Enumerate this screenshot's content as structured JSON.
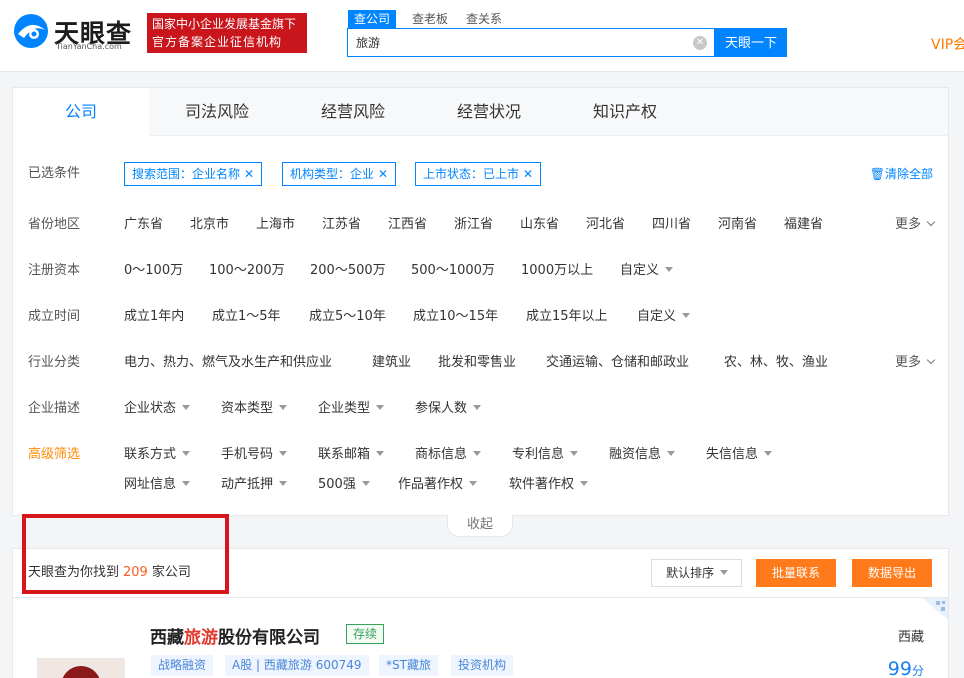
{
  "header": {
    "logo_cn": "天眼查",
    "logo_en": "TianYanCha.com",
    "badge_line1": "国家中小企业发展基金旗下",
    "badge_line2": "官方备案企业征信机构",
    "search_tabs": [
      "查公司",
      "查老板",
      "查关系"
    ],
    "search_value": "旅游",
    "search_button": "天眼一下",
    "vip": "VIP会"
  },
  "category_tabs": [
    "公司",
    "司法风险",
    "经营风险",
    "经营状况",
    "知识产权"
  ],
  "filters": {
    "selected": {
      "label": "已选条件",
      "chips": [
        "搜索范围：企业名称",
        "机构类型：企业",
        "上市状态：已上市"
      ],
      "clear_all": "清除全部"
    },
    "province": {
      "label": "省份地区",
      "options": [
        "广东省",
        "北京市",
        "上海市",
        "江苏省",
        "江西省",
        "浙江省",
        "山东省",
        "河北省",
        "四川省",
        "河南省",
        "福建省"
      ],
      "more": "更多"
    },
    "capital": {
      "label": "注册资本",
      "options": [
        "0～100万",
        "100～200万",
        "200～500万",
        "500～1000万",
        "1000万以上"
      ],
      "custom": "自定义"
    },
    "established": {
      "label": "成立时间",
      "options": [
        "成立1年内",
        "成立1～5年",
        "成立5～10年",
        "成立10～15年",
        "成立15年以上"
      ],
      "custom": "自定义"
    },
    "industry": {
      "label": "行业分类",
      "options": [
        "电力、热力、燃气及水生产和供应业",
        "建筑业",
        "批发和零售业",
        "交通运输、仓储和邮政业",
        "农、林、牧、渔业"
      ],
      "more": "更多"
    },
    "description": {
      "label": "企业描述",
      "dropdowns": [
        "企业状态",
        "资本类型",
        "企业类型",
        "参保人数"
      ]
    },
    "advanced": {
      "label": "高级筛选",
      "row1": [
        "联系方式",
        "手机号码",
        "联系邮箱",
        "商标信息",
        "专利信息",
        "融资信息",
        "失信信息"
      ],
      "row2": [
        "网址信息",
        "动产抵押",
        "500强",
        "作品著作权",
        "软件著作权"
      ]
    },
    "collapse": "收起"
  },
  "results": {
    "prefix": "天眼查为你找到",
    "count": "209",
    "suffix": "家公司",
    "sort": "默认排序",
    "bulk_contact": "批量联系",
    "export": "数据导出"
  },
  "company": {
    "name_pre": "西藏",
    "name_hl": "旅游",
    "name_post": "股份有限公司",
    "status": "存续",
    "tags": [
      "战略融资",
      "A股 | 西藏旅游 600749",
      "*ST藏旅",
      "投资机构"
    ],
    "region": "西藏",
    "score": "99",
    "score_unit": "分"
  },
  "colors": {
    "brand_blue": "#0084ff",
    "orange": "#ff7a1a",
    "badge_red": "#c9161d",
    "highlight_red": "#d6161c"
  }
}
